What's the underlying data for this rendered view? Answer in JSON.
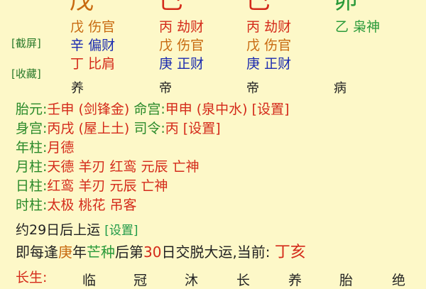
{
  "top_stems": [
    {
      "char": "戊",
      "color": "#c86a10"
    },
    {
      "char": "巳",
      "color": "#d42a1a"
    },
    {
      "char": "巳",
      "color": "#d42a1a"
    },
    {
      "char": "卯",
      "color": "#2a9a3a"
    }
  ],
  "side_buttons": {
    "screenshot": "[截屏]",
    "favorite": "[收藏]"
  },
  "hidden_stems": {
    "col1": [
      {
        "stem": "戊",
        "god": "伤官",
        "color": "#c86a10"
      },
      {
        "stem": "辛",
        "god": "偏财",
        "color": "#1a2ab0"
      },
      {
        "stem": "丁",
        "god": "比肩",
        "color": "#d42a1a"
      }
    ],
    "col2": [
      {
        "stem": "丙",
        "god": "劫财",
        "color": "#d42a1a"
      },
      {
        "stem": "戊",
        "god": "伤官",
        "color": "#c86a10"
      },
      {
        "stem": "庚",
        "god": "正财",
        "color": "#1a2ab0"
      }
    ],
    "col3": [
      {
        "stem": "丙",
        "god": "劫财",
        "color": "#d42a1a"
      },
      {
        "stem": "戊",
        "god": "伤官",
        "color": "#c86a10"
      },
      {
        "stem": "庚",
        "god": "正财",
        "color": "#1a2ab0"
      }
    ],
    "col4": [
      {
        "stem": "乙",
        "god": "枭神",
        "color": "#2a9a3a"
      }
    ]
  },
  "life_stages_top": [
    "养",
    "帝",
    "帝",
    "病"
  ],
  "info": {
    "taiyuan_label": "胎元:",
    "taiyuan_value": "壬申 (剑锋金)",
    "minggong_label": "命宫:",
    "minggong_value": "甲申 (泉中水)",
    "minggong_set": "[设置]",
    "shengong_label": "身宫:",
    "shengong_value": "丙戌 (屋上土)",
    "siling_label": "司令:",
    "siling_value": "丙",
    "siling_set": "[设置]"
  },
  "pillars": [
    {
      "label": "年柱:",
      "value": "月德"
    },
    {
      "label": "月柱:",
      "value": "天德 羊刃 红鸾 元辰 亡神"
    },
    {
      "label": "日柱:",
      "value": "红鸾 羊刃 元辰 亡神"
    },
    {
      "label": "时柱:",
      "value": "太极 桃花 吊客"
    }
  ],
  "luck": {
    "start": "约29日后上运",
    "start_set": "[设置]",
    "p1": "即每逢",
    "p2": "庚",
    "p3": "年",
    "p4": "芒种",
    "p5": "后第",
    "p6": "30",
    "p7": "日交脱大运,当前:",
    "p8": "丁亥"
  },
  "bottom": {
    "label": "长生:",
    "stages": [
      "临",
      "冠",
      "沐",
      "长",
      "养",
      "胎",
      "绝"
    ]
  }
}
